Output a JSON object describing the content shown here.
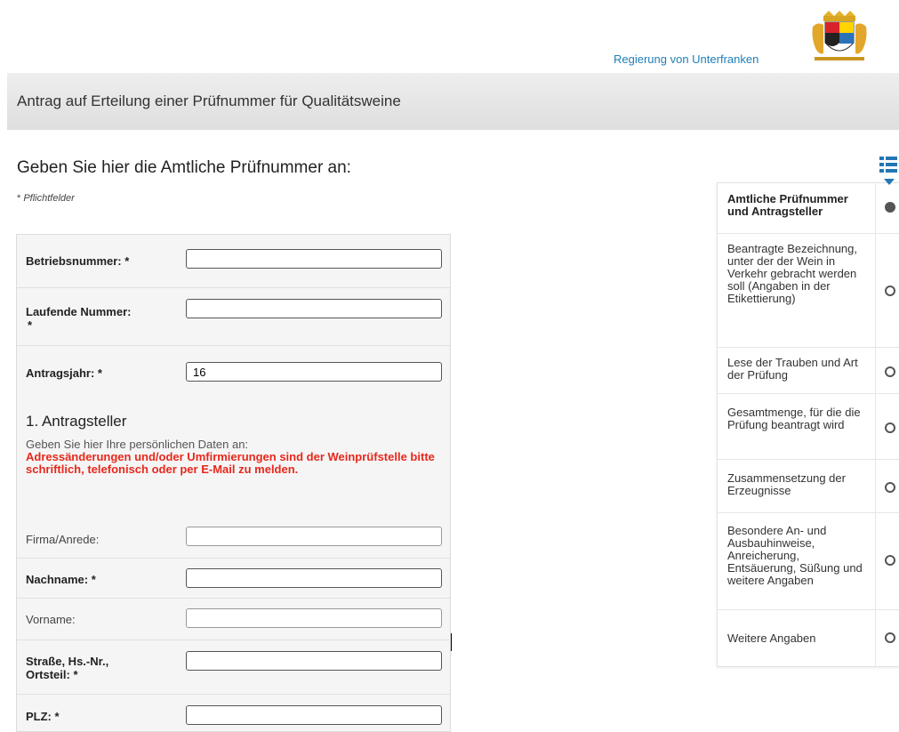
{
  "header": {
    "agency": "Regierung von Unterfranken"
  },
  "titlebar": {
    "title": "Antrag auf Erteilung einer Prüfnummer für Qualitätsweine"
  },
  "main": {
    "heading": "Geben Sie hier die Amtliche Prüfnummer an:",
    "required_star": "*",
    "required_note": "Pflichtfelder"
  },
  "form": {
    "betriebsnummer_label": "Betriebsnummer: *",
    "betriebsnummer_value": "",
    "laufende_label_line1": "Laufende Nummer:",
    "laufende_label_line2": "*",
    "laufende_value": "",
    "antragsjahr_label": "Antragsjahr: *",
    "antragsjahr_value": "16",
    "section_title": "1. Antragsteller",
    "section_hint": "Geben Sie hier Ihre persönlichen Daten an:",
    "section_warning": "Adressänderungen und/oder Umfirmierungen sind der Weinprüfstelle bitte schriftlich, telefonisch oder per E-Mail zu melden.",
    "firma_label": "Firma/Anrede:",
    "firma_value": "",
    "nachname_label": "Nachname: *",
    "nachname_value": "",
    "vorname_label": "Vorname:",
    "vorname_value": "",
    "strasse_label_line1": "Straße, Hs.-Nr.,",
    "strasse_label_line2": "Ortsteil: *",
    "strasse_value": "",
    "plz_label": "PLZ: *",
    "plz_value": ""
  },
  "nav": {
    "icon": "list-icon",
    "items": [
      {
        "label": "Amtliche Prüfnummer und Antragsteller",
        "state": "active"
      },
      {
        "label": "Beantragte Bezeichnung, unter der der Wein in Verkehr gebracht werden soll (Angaben in der Etikettierung)",
        "state": "pending"
      },
      {
        "label": "Lese der Trauben und Art der Prüfung",
        "state": "pending"
      },
      {
        "label": "Gesamtmenge, für die die Prüfung beantragt wird",
        "state": "pending"
      },
      {
        "label": "Zusammensetzung der Erzeugnisse",
        "state": "pending"
      },
      {
        "label": "Besondere An- und Ausbauhinweise, Anreicherung, Entsäuerung, Süßung und weitere Angaben",
        "state": "pending"
      },
      {
        "label": "Weitere Angaben",
        "state": "pending"
      }
    ]
  },
  "colors": {
    "link": "#1f7fb6",
    "warning": "#e8281c",
    "accent": "#2376b5"
  }
}
